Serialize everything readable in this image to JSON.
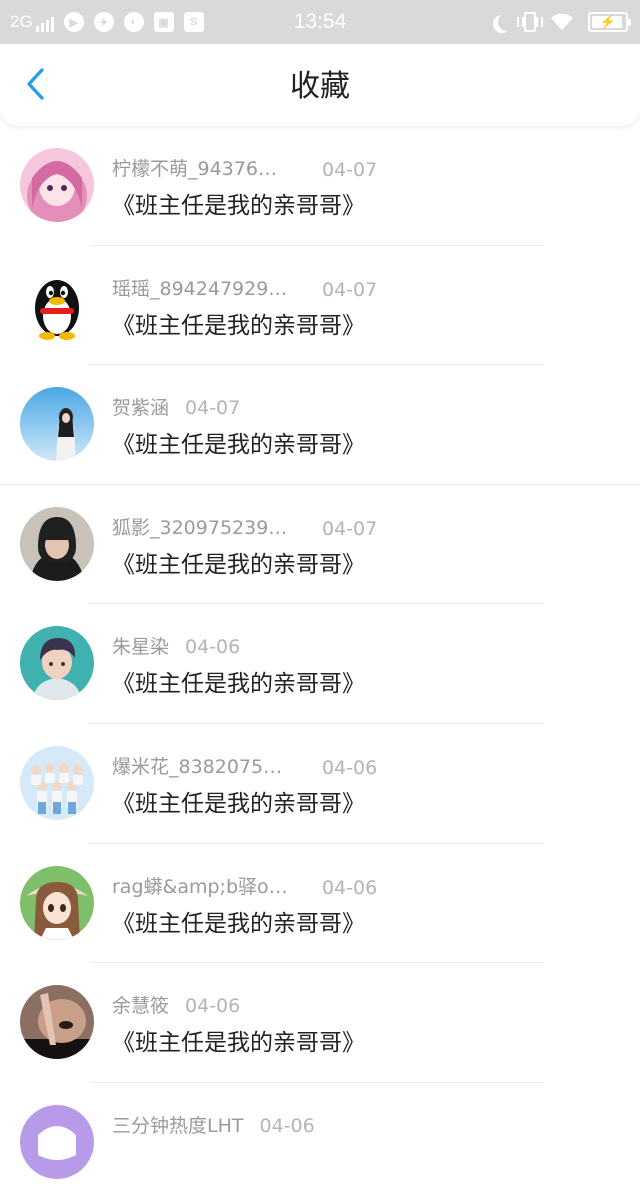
{
  "status_bar": {
    "network": "2G",
    "time": "13:54",
    "app_icons": [
      "video-icon",
      "game-icon",
      "browser-icon",
      "image-icon",
      "s-app-icon"
    ],
    "right_icons": [
      "moon-icon",
      "vibrate-icon",
      "wifi-icon",
      "battery-icon"
    ]
  },
  "nav": {
    "title": "收藏",
    "back_icon": "chevron-left-icon",
    "accent": "#2a9fe8"
  },
  "favorites": [
    {
      "user": "柠檬不萌_94376…",
      "date": "04-07",
      "title": "《班主任是我的亲哥哥》",
      "avatar": "pink-anime-girl"
    },
    {
      "user": "瑶瑶_894247929…",
      "date": "04-07",
      "title": "《班主任是我的亲哥哥》",
      "avatar": "penguin"
    },
    {
      "user": "贺紫涵",
      "date": "04-07",
      "title": "《班主任是我的亲哥哥》",
      "avatar": "girl-sky"
    },
    {
      "user": "狐影_320975239…",
      "date": "04-07",
      "title": "《班主任是我的亲哥哥》",
      "avatar": "hooded-boy"
    },
    {
      "user": "朱星染",
      "date": "04-06",
      "title": "《班主任是我的亲哥哥》",
      "avatar": "boy-teal"
    },
    {
      "user": "爆米花_8382075…",
      "date": "04-06",
      "title": "《班主任是我的亲哥哥》",
      "avatar": "group-photo"
    },
    {
      "user": "rag蟒&amp;b驿o…",
      "date": "04-06",
      "title": "《班主任是我的亲哥哥》",
      "avatar": "anime-girl-hat"
    },
    {
      "user": "余慧筱",
      "date": "04-06",
      "title": "《班主任是我的亲哥哥》",
      "avatar": "hand-face"
    },
    {
      "user": "三分钟热度LHT",
      "date": "04-06",
      "title": "",
      "avatar": "purple-cartoon"
    }
  ]
}
